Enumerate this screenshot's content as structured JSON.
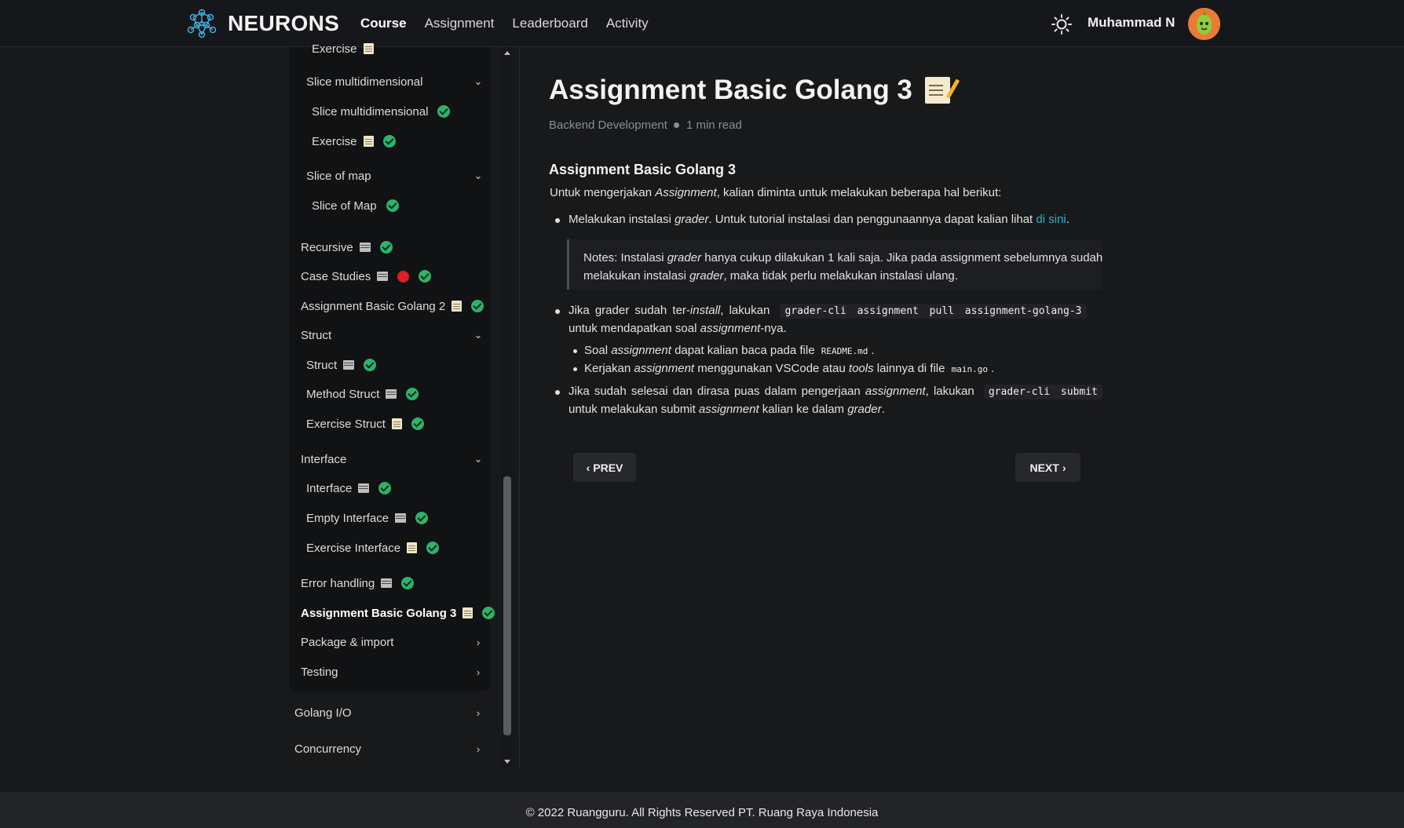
{
  "navbar": {
    "brand": "NEURONS",
    "links": [
      {
        "label": "Course",
        "active": true
      },
      {
        "label": "Assignment",
        "active": false
      },
      {
        "label": "Leaderboard",
        "active": false
      },
      {
        "label": "Activity",
        "active": false
      }
    ],
    "user_name": "Muhammad N",
    "icons": {
      "brand": "neuron-network-icon",
      "theme": "sun-icon",
      "avatar": "avatar-icon"
    }
  },
  "sidebar": {
    "items": [
      {
        "label": "Exercise",
        "icon": "doc-icon"
      },
      {
        "label": "Slice multidimensional",
        "icon": "chevron-down-icon"
      },
      {
        "label": "Slice multidimensional",
        "icon": "check-icon"
      },
      {
        "label": "Exercise",
        "icon": "doc-icon"
      },
      {
        "label": "Slice of map",
        "icon": "chevron-down-icon"
      },
      {
        "label": "Slice of Map",
        "icon": "check-icon"
      },
      {
        "label": "Recursive",
        "icon": "video-icon"
      },
      {
        "label": "Case Studies",
        "icon": "video-icon"
      },
      {
        "label": "Assignment Basic Golang 2",
        "icon": "doc-icon"
      },
      {
        "label": "Struct",
        "icon": "chevron-down-icon"
      },
      {
        "label": "Struct",
        "icon": "video-icon"
      },
      {
        "label": "Method Struct",
        "icon": "video-icon"
      },
      {
        "label": "Exercise Struct",
        "icon": "doc-icon"
      },
      {
        "label": "Interface",
        "icon": "chevron-down-icon"
      },
      {
        "label": "Interface",
        "icon": "video-icon"
      },
      {
        "label": "Empty Interface",
        "icon": "video-icon"
      },
      {
        "label": "Exercise Interface",
        "icon": "doc-icon"
      },
      {
        "label": "Error handling",
        "icon": "video-icon"
      },
      {
        "label": "Assignment Basic Golang 3",
        "icon": "doc-icon",
        "active": true
      },
      {
        "label": "Package & import",
        "icon": "chevron-right-icon"
      },
      {
        "label": "Testing",
        "icon": "chevron-right-icon"
      },
      {
        "label": "Golang I/O",
        "icon": "chevron-right-icon"
      },
      {
        "label": "Concurrency",
        "icon": "chevron-right-icon"
      }
    ],
    "status_colors": {
      "done": "#2db36a",
      "live": "#e01e24"
    }
  },
  "main": {
    "title": "Assignment Basic Golang 3",
    "meta": {
      "category": "Backend Development",
      "read_time": "1 min read"
    },
    "heading": "Assignment Basic Golang 3",
    "intro": {
      "a": "Untuk mengerjakan ",
      "b": "Assignment",
      "c": ", kalian diminta untuk melakukan beberapa hal berikut:"
    },
    "b1": {
      "a": "Melakukan instalasi ",
      "b": "grader",
      "c": ". Untuk tutorial instalasi dan penggunaannya dapat kalian lihat ",
      "link": "di sini",
      "d": "."
    },
    "notes": {
      "l1a": "Notes: Instalasi ",
      "l1b": "grader",
      "l1c": " hanya cukup dilakukan 1 kali saja. Jika pada assignment sebelumnya sudah",
      "l2a": "melakukan instalasi ",
      "l2b": "grader",
      "l2c": ", maka tidak perlu melakukan instalasi ulang."
    },
    "b2": {
      "a": "Jika grader sudah ter-",
      "b": "install",
      "c": ", lakukan",
      "code": "grader-cli assignment pull assignment-golang-3",
      "l2a": "untuk mendapatkan soal ",
      "l2b": "assignment",
      "l2c": "-nya."
    },
    "s1": {
      "a": "Soal ",
      "b": "assignment",
      "c": " dapat kalian baca pada file ",
      "code": "README.md",
      "d": "."
    },
    "s2": {
      "a": "Kerjakan ",
      "b": "assignment",
      "c": " menggunakan VSCode atau ",
      "d": "tools",
      "e": " lainnya di file ",
      "code": "main.go",
      "f": "."
    },
    "b3": {
      "a": "Jika sudah selesai dan dirasa puas dalam pengerjaan ",
      "b": "assignment",
      "c": ", lakukan",
      "code": "grader-cli submit",
      "l2a": "untuk melakukan submit ",
      "l2b": "assignment",
      "l2c": " kalian ke dalam ",
      "l2d": "grader",
      "l2e": "."
    },
    "prev_label": "PREV",
    "next_label": "NEXT"
  },
  "footer": {
    "text": "© 2022 Ruangguru. All Rights Reserved PT. Ruang Raya Indonesia"
  }
}
